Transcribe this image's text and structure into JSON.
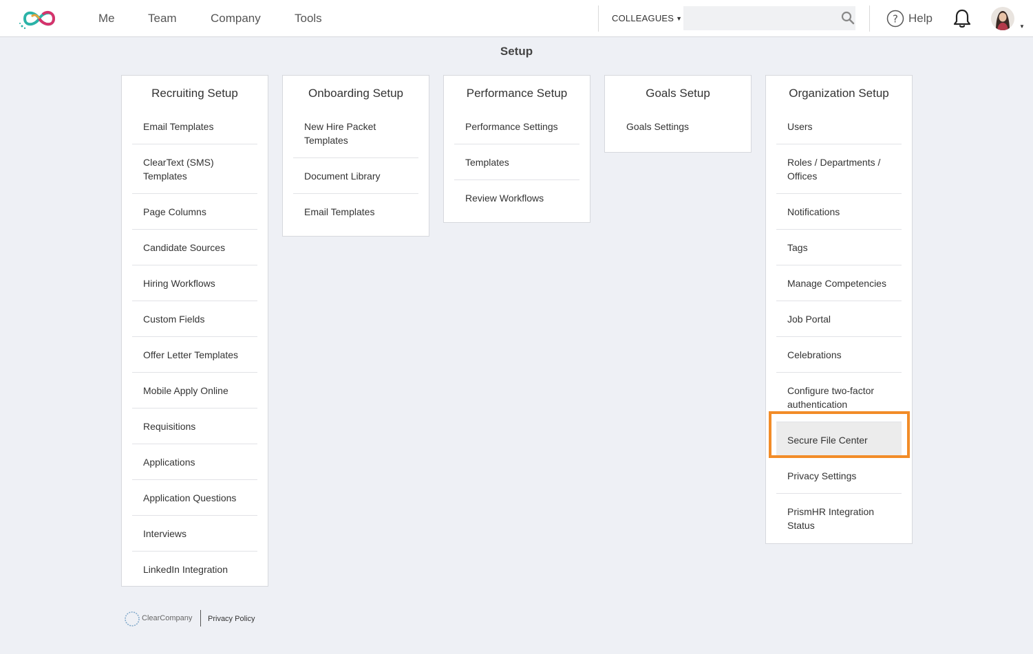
{
  "header": {
    "nav": [
      "Me",
      "Team",
      "Company",
      "Tools"
    ],
    "colleagues_label": "COLLEAGUES",
    "search_placeholder": "",
    "help_label": "Help"
  },
  "page": {
    "title": "Setup"
  },
  "cards": [
    {
      "title": "Recruiting Setup",
      "items": [
        "Email Templates",
        "ClearText (SMS) Templates",
        "Page Columns",
        "Candidate Sources",
        "Hiring Workflows",
        "Custom Fields",
        "Offer Letter Templates",
        "Mobile Apply Online",
        "Requisitions",
        "Applications",
        "Application Questions",
        "Interviews",
        "LinkedIn Integration"
      ]
    },
    {
      "title": "Onboarding Setup",
      "items": [
        "New Hire Packet Templates",
        "Document Library",
        "Email Templates"
      ]
    },
    {
      "title": "Performance Setup",
      "items": [
        "Performance Settings",
        "Templates",
        "Review Workflows"
      ]
    },
    {
      "title": "Goals Setup",
      "items": [
        "Goals Settings"
      ]
    },
    {
      "title": "Organization Setup",
      "items": [
        "Users",
        "Roles / Departments / Offices",
        "Notifications",
        "Tags",
        "Manage Competencies",
        "Job Portal",
        "Celebrations",
        "Configure two-factor authentication",
        "Secure File Center",
        "Privacy Settings",
        "PrismHR Integration Status"
      ],
      "highlighted_item": "Secure File Center"
    }
  ],
  "footer": {
    "brand": "ClearCompany",
    "privacy_link": "Privacy Policy"
  },
  "colors": {
    "background": "#eef0f5",
    "highlight_border": "#f28c28",
    "logo_teal": "#2bb3a8",
    "logo_pink": "#d6336c"
  }
}
